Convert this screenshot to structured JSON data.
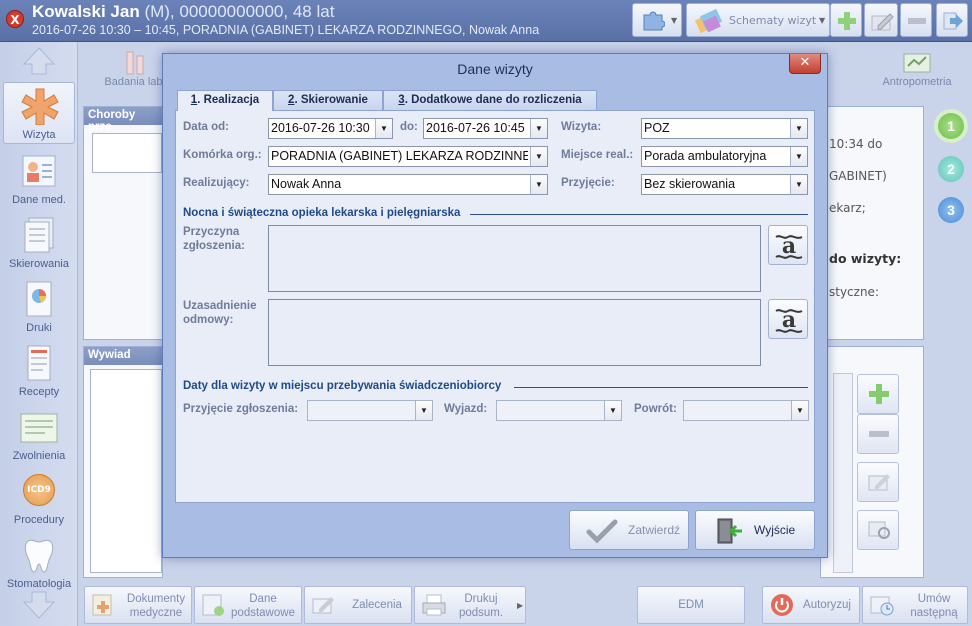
{
  "header": {
    "patient_name": "Kowalski Jan",
    "patient_details": "(M), 00000000000, 48 lat",
    "visit_info": "2016-07-26 10:30 – 10:45, PORADNIA (GABINET) LEKARZA RODZINNEGO, Nowak Anna",
    "schematy_label": "Schematy wizyt"
  },
  "sidebar": {
    "items": [
      {
        "label": "Wizyta",
        "icon": "caduceus-icon"
      },
      {
        "label": "Dane med.",
        "icon": "patient-card-icon"
      },
      {
        "label": "Skierowania",
        "icon": "documents-icon"
      },
      {
        "label": "Druki",
        "icon": "print-chart-icon"
      },
      {
        "label": "Recepty",
        "icon": "prescription-icon"
      },
      {
        "label": "Zwolnienia",
        "icon": "sick-leave-icon"
      },
      {
        "label": "Procedury",
        "icon": "icd9-icon"
      },
      {
        "label": "Stomatologia",
        "icon": "tooth-icon"
      }
    ],
    "icd_text": "ICD9"
  },
  "background": {
    "toptab_left": "Badania lab.",
    "toptab_right": "Antropometria",
    "panel1_title": "Choroby prze",
    "panel2_title": "Wywiad",
    "right_text": [
      "10:34 do",
      "GABINET)",
      "ekarz;",
      "do wizyty:",
      "styczne:"
    ],
    "steps": [
      "1",
      "2",
      "3"
    ]
  },
  "dialog": {
    "title": "Dane wizyty",
    "tabs": [
      {
        "hot": "1",
        "rest": ". Realizacja"
      },
      {
        "hot": "2",
        "rest": ". Skierowanie"
      },
      {
        "hot": "3",
        "rest": ". Dodatkowe dane do rozliczenia"
      }
    ],
    "fields": {
      "data_od_label": "Data od:",
      "data_od_value": "2016-07-26 10:30",
      "do_label": "do:",
      "do_value": "2016-07-26 10:45",
      "wizyta_label": "Wizyta:",
      "wizyta_value": "POZ",
      "komorka_label": "Komórka org.:",
      "komorka_value": "PORADNIA (GABINET) LEKARZA RODZINNEGO",
      "miejsce_label": "Miejsce real.:",
      "miejsce_value": "Porada ambulatoryjna",
      "realizujacy_label": "Realizujący:",
      "realizujacy_value": "Nowak Anna",
      "przyjecie_label": "Przyjęcie:",
      "przyjecie_value": "Bez skierowania"
    },
    "section1": "Nocna i świąteczna opieka lekarska i pielęgniarska",
    "przyczyna_label": [
      "Przyczyna",
      "zgłoszenia:"
    ],
    "uzasadnienie_label": [
      "Uzasadnienie",
      "odmowy:"
    ],
    "section2": "Daty dla wizyty w miejscu przebywania świadczeniobiorcy",
    "przyjecie_zgl_label": "Przyjęcie zgłoszenia:",
    "wyjazd_label": "Wyjazd:",
    "powrot_label": "Powrót:",
    "btn_zatwierdz": "Zatwierdź",
    "btn_wyjscie": "Wyjście"
  },
  "bottom_toolbar": {
    "dokumenty": [
      "Dokumenty",
      "medyczne"
    ],
    "dane_podst": [
      "Dane",
      "podstawowe"
    ],
    "zalecenia": "Zalecenia",
    "drukuj": [
      "Drukuj",
      "podsum."
    ],
    "edm": "EDM",
    "autoryzuj": "Autoryzuj",
    "umow": [
      "Umów",
      "następną"
    ]
  },
  "colors": {
    "header_bg": "#5a71a6",
    "dialog_bg": "#a9bde4",
    "section_text": "#1f4a8a",
    "step1": "#7bc95a",
    "step2": "#6fd0c4",
    "step3": "#5b9ae0"
  }
}
